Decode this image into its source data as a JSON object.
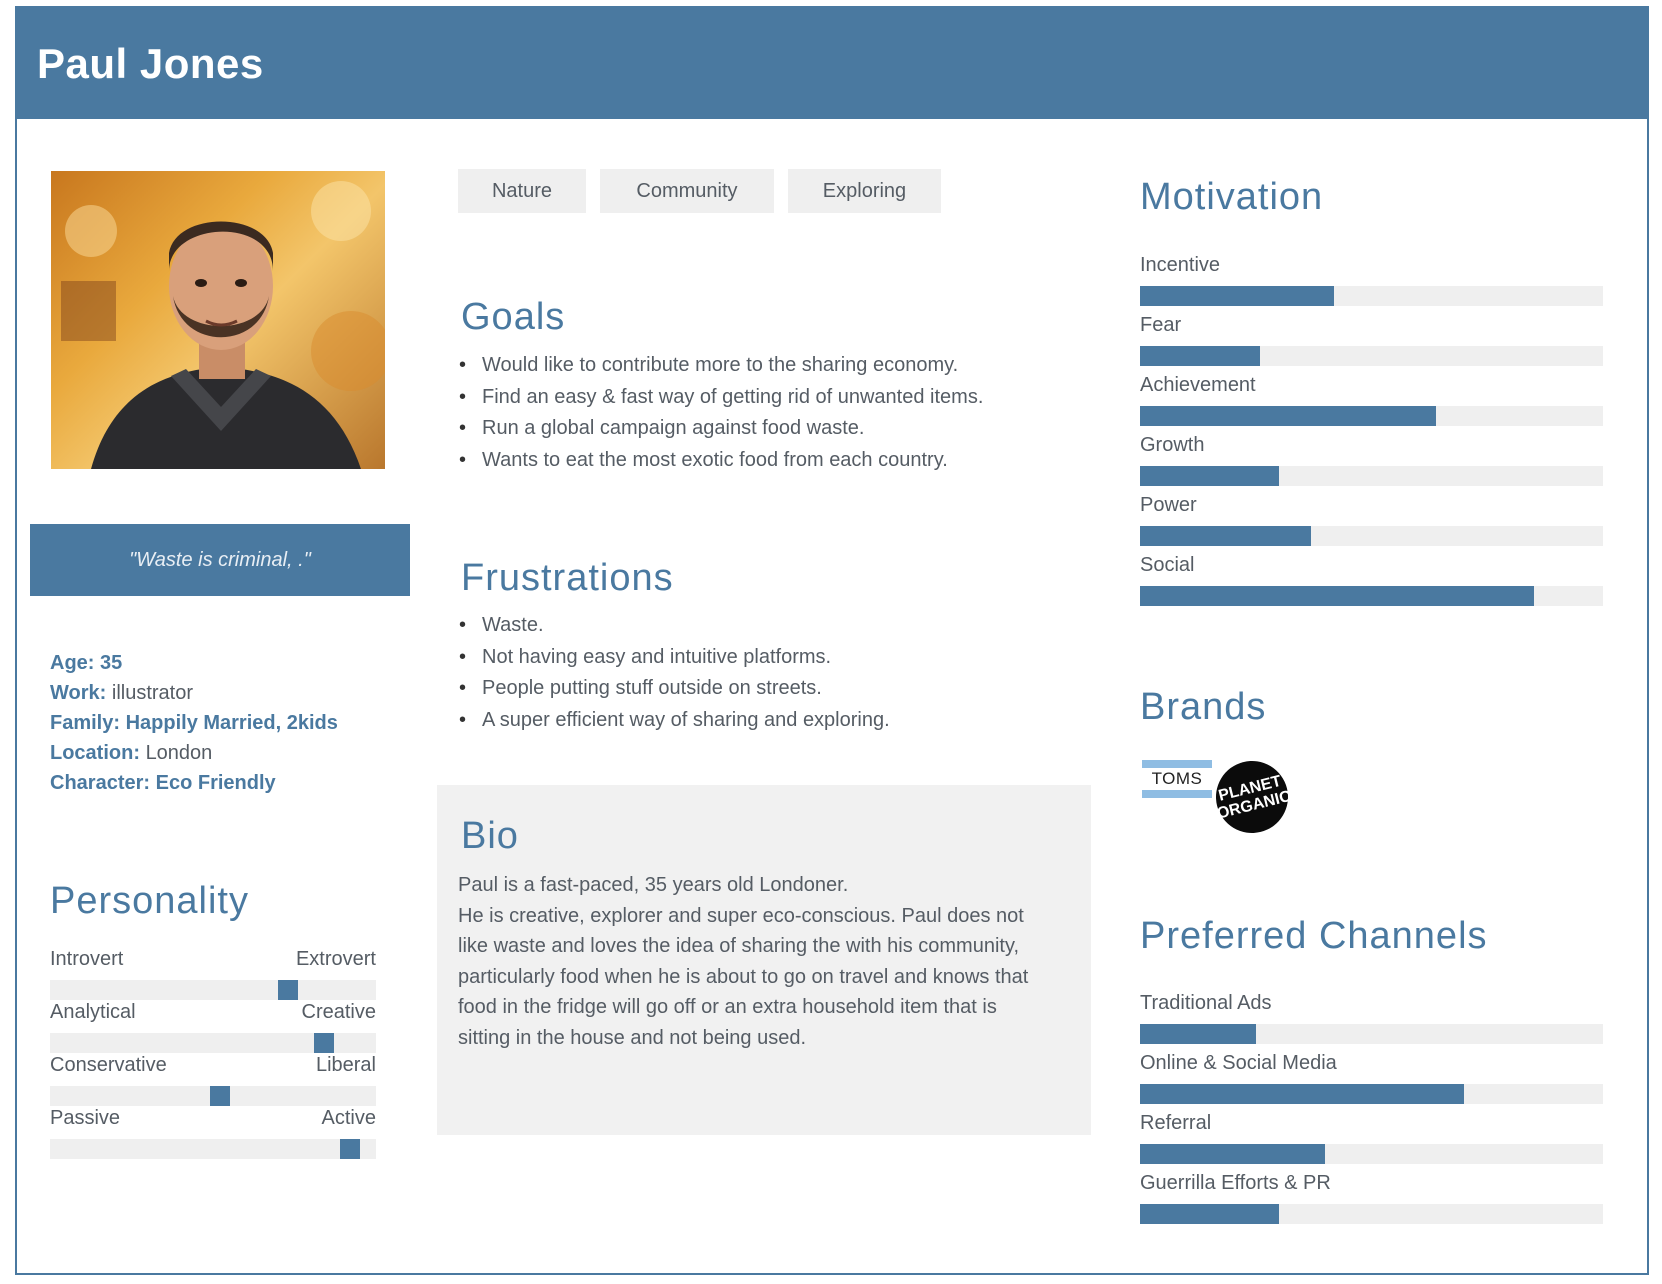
{
  "persona": {
    "name": "Paul Jones",
    "quote": "\"Waste is criminal, .\""
  },
  "facts": {
    "age_label": "Age:",
    "age_value": "35",
    "work_label": "Work:",
    "work_value": "illustrator",
    "family_text": "Family: Happily Married, 2kids",
    "location_label": "Location:",
    "location_value": "London",
    "character_label": "Character:",
    "character_value": "Eco Friendly"
  },
  "personality": {
    "title": "Personality",
    "scales": [
      {
        "left": "Introvert",
        "right": "Extrovert",
        "value": 0.73
      },
      {
        "left": "Analytical",
        "right": "Creative",
        "value": 0.84
      },
      {
        "left": "Conservative",
        "right": "Liberal",
        "value": 0.52
      },
      {
        "left": "Passive",
        "right": "Active",
        "value": 0.92
      }
    ]
  },
  "tags": [
    "Nature",
    "Community",
    "Exploring"
  ],
  "goals": {
    "title": "Goals",
    "items": [
      "Would like to contribute more to the sharing economy.",
      "Find an easy & fast way of getting rid of unwanted items.",
      "Run a global campaign against food waste.",
      "Wants to eat the most exotic food from each country."
    ]
  },
  "frustrations": {
    "title": "Frustrations",
    "items": [
      "Waste.",
      "Not having easy and intuitive platforms.",
      "People putting stuff outside on streets.",
      "A super efficient way of sharing and exploring."
    ]
  },
  "bio": {
    "title": "Bio",
    "lines": [
      "Paul is a fast-paced, 35 years old Londoner.",
      "He is creative, explorer and super eco-conscious. Paul does not",
      "like waste and loves the idea of sharing the with his community,",
      "particularly food when he is about to go on travel and knows that",
      "food in the fridge will go off or an extra household item that is",
      "sitting in the house and not being used."
    ]
  },
  "motivation": {
    "title": "Motivation",
    "items": [
      {
        "label": "Incentive",
        "value": 0.42
      },
      {
        "label": "Fear",
        "value": 0.26
      },
      {
        "label": "Achievement",
        "value": 0.64
      },
      {
        "label": "Growth",
        "value": 0.3
      },
      {
        "label": "Power",
        "value": 0.37
      },
      {
        "label": "Social",
        "value": 0.85
      }
    ]
  },
  "brands": {
    "title": "Brands",
    "logos": [
      {
        "name": "toms-logo",
        "text": "TOMS"
      },
      {
        "name": "planet-organic-logo",
        "line1": "PLANET",
        "line2": "ORGANIC"
      }
    ]
  },
  "channels": {
    "title": "Preferred Channels",
    "items": [
      {
        "label": "Traditional Ads",
        "value": 0.25
      },
      {
        "label": "Online & Social Media",
        "value": 0.7
      },
      {
        "label": "Referral",
        "value": 0.4
      },
      {
        "label": "Guerrilla Efforts & PR",
        "value": 0.3
      }
    ]
  },
  "colors": {
    "accent": "#4a79a0",
    "track": "#efefef",
    "text": "#555c64",
    "panel": "#f1f1f1"
  }
}
